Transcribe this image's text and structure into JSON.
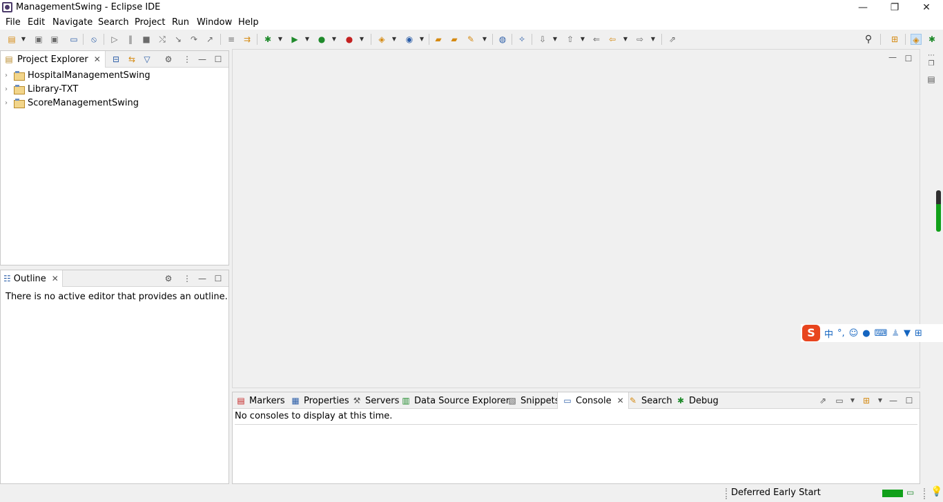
{
  "window": {
    "title": "ManagementSwing - Eclipse IDE",
    "minimize": "—",
    "restore": "❐",
    "close": "✕"
  },
  "menu": [
    "File",
    "Edit",
    "Navigate",
    "Search",
    "Project",
    "Run",
    "Window",
    "Help"
  ],
  "project_explorer": {
    "title": "Project Explorer",
    "projects": [
      "HospitalManagementSwing",
      "Library-TXT",
      "ScoreManagementSwing"
    ]
  },
  "outline": {
    "title": "Outline",
    "message": "There is no active editor that provides an outline."
  },
  "bottom_panel": {
    "tabs": [
      "Markers",
      "Properties",
      "Servers",
      "Data Source Explorer",
      "Snippets",
      "Console",
      "Search",
      "Debug"
    ],
    "active_tab": "Console",
    "message": "No consoles to display at this time."
  },
  "status": {
    "text": "Deferred Early Start"
  },
  "ime": {
    "lang": "中",
    "punct": "°,"
  },
  "colors": {
    "progress": "#11a01a",
    "ime_logo": "#e8451e"
  }
}
